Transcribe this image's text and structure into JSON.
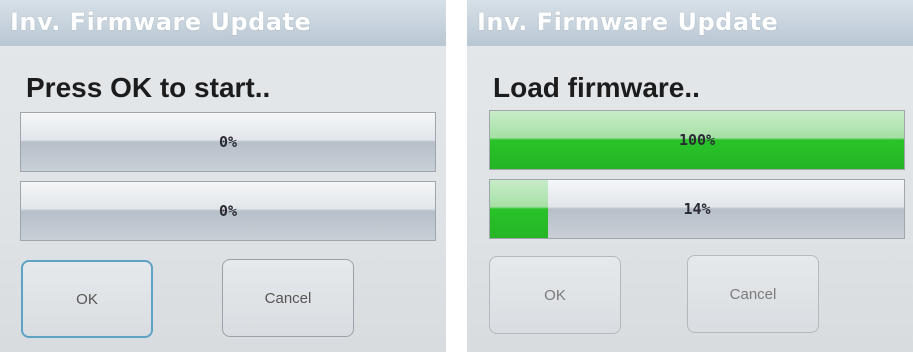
{
  "screens": [
    {
      "title": "Inv. Firmware Update",
      "status": "Press OK to start..",
      "progress": [
        {
          "label": "0%",
          "value": 0
        },
        {
          "label": "0%",
          "value": 0
        }
      ],
      "buttons": {
        "ok": "OK",
        "cancel": "Cancel"
      }
    },
    {
      "title": "Inv. Firmware Update",
      "status": "Load firmware..",
      "progress": [
        {
          "label": "100%",
          "value": 100
        },
        {
          "label": "14%",
          "value": 14
        }
      ],
      "buttons": {
        "ok": "OK",
        "cancel": "Cancel"
      }
    }
  ],
  "colors": {
    "title_bar": "#c3cfda",
    "progress_fill": "#29c329",
    "focus_border": "#5ea2c4"
  }
}
